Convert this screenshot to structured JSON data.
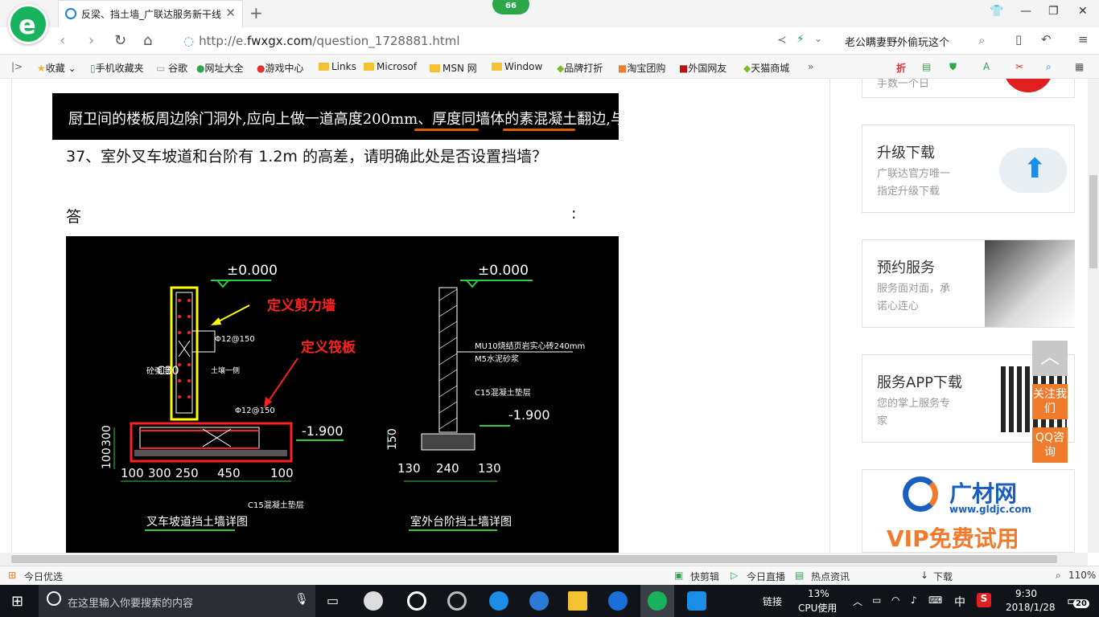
{
  "browser": {
    "tab_title": "反梁、挡土墙_广联达服务新干线",
    "badge": "66",
    "url_prefix": "http://e.",
    "url_domain": "fwxgx.com",
    "url_path": "/question_1728881.html",
    "hot_search": "老公瞒妻野外偷玩这个"
  },
  "bookmarks": [
    {
      "label": "收藏"
    },
    {
      "label": "手机收藏夹"
    },
    {
      "label": "谷歌"
    },
    {
      "label": "网址大全"
    },
    {
      "label": "游戏中心"
    },
    {
      "label": "Links"
    },
    {
      "label": "Microsof"
    },
    {
      "label": "MSN 网"
    },
    {
      "label": "Window"
    },
    {
      "label": "品牌打折"
    },
    {
      "label": "淘宝团购"
    },
    {
      "label": "外国网友"
    },
    {
      "label": "天猫商城"
    }
  ],
  "content": {
    "banner_text": "厨卫间的楼板周边除门洞外,应向上做一道高度200mm、厚度同墙体的素混凝土翻边,与梁板一同浇筑。",
    "question": "37、室外叉车坡道和台阶有 1.2m 的高差，请明确此处是否设置挡墙？",
    "answer_label": "答",
    "answer_colon": ":"
  },
  "drawing": {
    "elev_left": "±0.000",
    "elev_right": "±0.000",
    "label_wall": "定义剪力墙",
    "label_raft": "定义筏板",
    "rebar1": "Φ12@150",
    "rebar2": "Φ12@150",
    "concrete": "C30",
    "concrete_prefix": "砼强度",
    "backfill": "土壤一侧",
    "elev_low_left": "-1.900",
    "elev_low_right": "-1.900",
    "brick": "MU10烧结页岩实心砖240mm",
    "mortar": "M5水泥砂浆",
    "cushion_right": "C15混凝土垫层",
    "cushion_left": "C15混凝土垫层",
    "dims_left": [
      "100",
      "300",
      "250",
      "450",
      "100"
    ],
    "dims_left_vertical": [
      "300",
      "100"
    ],
    "dims_right": [
      "130",
      "240",
      "130"
    ],
    "dim_right_vertical": "150",
    "title_left": "叉车坡道挡土墙详图",
    "title_right": "室外台阶挡土墙详图"
  },
  "sidebar": {
    "cards": [
      {
        "title": "升级下载",
        "desc1": "广联达官方唯一",
        "desc2": "指定升级下载"
      },
      {
        "title": "预约服务",
        "desc1": "服务面对面，承",
        "desc2": "诺心连心"
      },
      {
        "title": "服务APP下载",
        "desc1": "您的掌上服务专",
        "desc2": "家"
      }
    ],
    "top_partial": "手数一个日",
    "follow_btn": "关注我们",
    "qq_btn": "QQ咨询",
    "ad_brand": "广材网",
    "ad_url": "www.gldjc.com",
    "ad_slogan": "VIP免费试用"
  },
  "statusbar": {
    "left": "今日优选",
    "items": [
      "快剪辑",
      "今日直播",
      "热点资讯",
      "下载"
    ],
    "zoom": "110%"
  },
  "taskbar": {
    "search_placeholder": "在这里输入你要搜索的内容",
    "link_label": "链接",
    "cpu_pct": "13%",
    "cpu_label": "CPU使用",
    "ime": "中",
    "time": "9:30",
    "date": "2018/1/28",
    "notif_count": "20"
  },
  "colors": {
    "accent_green": "#19b35d",
    "cad_red": "#ff2020",
    "cad_green": "#2ecc40",
    "sidebar_orange": "#f07b2a"
  }
}
